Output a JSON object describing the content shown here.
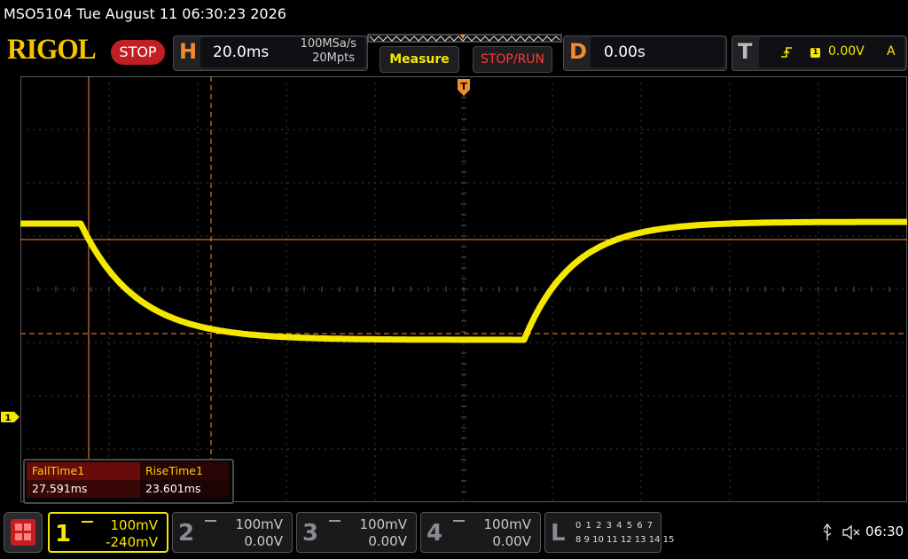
{
  "status_line": "MSO5104  Tue August 11 06:30:23 2026",
  "brand": "RIGOL",
  "run_state": "STOP",
  "horizontal": {
    "letter": "H",
    "timebase": "20.0ms",
    "sample_rate": "100MSa/s",
    "memory_depth": "20Mpts"
  },
  "buttons": {
    "measure": "Measure",
    "stop_run": "STOP/RUN"
  },
  "delay": {
    "letter": "D",
    "value": "0.00s"
  },
  "trigger": {
    "letter": "T",
    "channel": "1",
    "level": "0.00V",
    "mode": "A",
    "edge_icon": "rising-edge-icon"
  },
  "markers": {
    "trigger_marker": "T",
    "channel1_ground_marker": "1"
  },
  "measurements": [
    {
      "name": "FallTime1",
      "value": "27.591ms"
    },
    {
      "name": "RiseTime1",
      "value": "23.601ms"
    }
  ],
  "channels": [
    {
      "number": "1",
      "scale": "100mV",
      "offset": "-240mV",
      "active": true,
      "color": "#f5e800"
    },
    {
      "number": "2",
      "scale": "100mV",
      "offset": "0.00V",
      "active": false,
      "color": "#9a9aa0"
    },
    {
      "number": "3",
      "scale": "100mV",
      "offset": "0.00V",
      "active": false,
      "color": "#9a9aa0"
    },
    {
      "number": "4",
      "scale": "100mV",
      "offset": "0.00V",
      "active": false,
      "color": "#9a9aa0"
    }
  ],
  "logic": {
    "letter": "L",
    "row1": "0 1 2 3   4 5 6 7",
    "row2": "8 9 10 11  12 13 14 15"
  },
  "system": {
    "clock": "06:30",
    "usb_icon": "usb-icon",
    "sound_icon": "speaker-muted-icon"
  },
  "colors": {
    "trace": "#f5e800",
    "cursor": "#ff8a3d",
    "brand": "#f5c400",
    "stop": "#c02023"
  }
}
